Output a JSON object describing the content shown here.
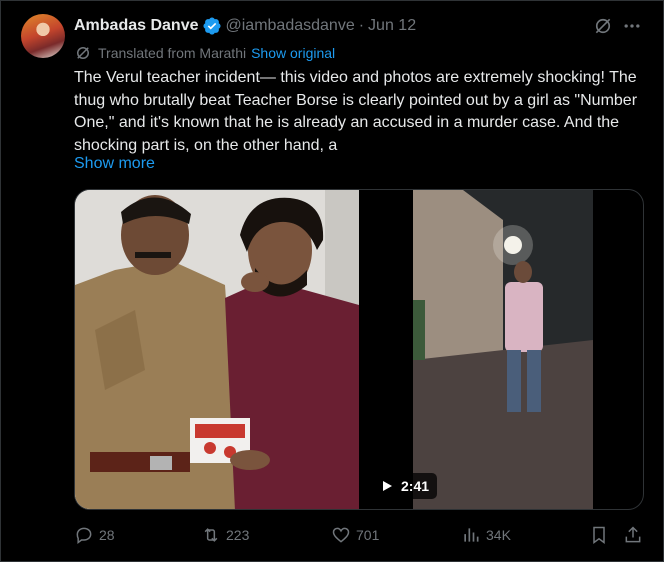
{
  "post": {
    "author_name": "Ambadas Danve",
    "handle": "@iambadasdanve",
    "separator": "·",
    "date": "Jun 12",
    "translated_label": "Translated from Marathi",
    "show_original": "Show original",
    "text": "The Verul teacher incident— this video and photos are extremely shocking! The thug who brutally beat Teacher Borse is clearly pointed out by a girl as \"Number One,\" and it's known that he is already an accused in a murder case. And the shocking part is, on the other hand, a",
    "show_more": "Show more",
    "video_duration": "2:41"
  },
  "actions": {
    "replies": "28",
    "reposts": "223",
    "likes": "701",
    "views": "34K"
  },
  "colors": {
    "background": "#000000",
    "accent": "#1d9bf0",
    "muted": "#71767b",
    "text": "#e7e9ea"
  },
  "icons": [
    "verified-badge-icon",
    "grok-icon",
    "more-icon",
    "translate-icon",
    "play-icon",
    "reply-icon",
    "repost-icon",
    "like-icon",
    "views-icon",
    "bookmark-icon",
    "share-icon"
  ]
}
